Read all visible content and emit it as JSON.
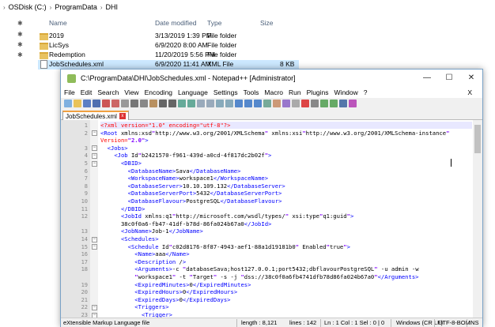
{
  "explorer": {
    "breadcrumb": [
      "OSDisk (C:)",
      "ProgramData",
      "DHI"
    ],
    "columns": {
      "name": "Name",
      "date": "Date modified",
      "type": "Type",
      "size": "Size"
    },
    "files": [
      {
        "name": "2019",
        "date": "3/13/2019 1:39 PM",
        "type": "File folder",
        "size": "",
        "icon": "folder-icon"
      },
      {
        "name": "LicSys",
        "date": "6/9/2020 8:00 AM",
        "type": "File folder",
        "size": "",
        "icon": "folder-icon"
      },
      {
        "name": "Redemption",
        "date": "11/20/2019 5:56 PM",
        "type": "File folder",
        "size": "",
        "icon": "folder-icon"
      },
      {
        "name": "JobSchedules.xml",
        "date": "6/9/2020 11:41 AM",
        "type": "XML File",
        "size": "8 KB",
        "icon": "xml-file-icon"
      }
    ]
  },
  "npp": {
    "title": "C:\\ProgramData\\DHI\\JobSchedules.xml - Notepad++ [Administrator]",
    "menu": [
      "File",
      "Edit",
      "Search",
      "View",
      "Encoding",
      "Language",
      "Settings",
      "Tools",
      "Macro",
      "Run",
      "Plugins",
      "Window",
      "?"
    ],
    "menu_close": "X",
    "tab_label": "JobSchedules.xml",
    "tab_close": "x",
    "minimize": "—",
    "maximize": "☐",
    "close": "✕",
    "lines": [
      {
        "n": "1",
        "fold": "",
        "text": "<?xml version=\"1.0\" encoding=\"utf-8\"?>"
      },
      {
        "n": "2",
        "fold": "−",
        "text": "<Root xmlns:xsd=\"http://www.w3.org/2001/XMLSchema\" xmlns:xsi=\"http://www.w3.org/2001/XMLSchema-instance\""
      },
      {
        "n": "",
        "fold": "",
        "text": "Version=\"2.0\">"
      },
      {
        "n": "3",
        "fold": "−",
        "text": "<Jobs>"
      },
      {
        "n": "4",
        "fold": "−",
        "text": "<Job Id=\"b2421570-f961-439d-a0cd-4f817dc2b02f\">"
      },
      {
        "n": "5",
        "fold": "−",
        "text": "<DBID>"
      },
      {
        "n": "6",
        "fold": "",
        "text": "<DatabaseName>Sava</DatabaseName>"
      },
      {
        "n": "7",
        "fold": "",
        "text": "<WorkspaceName>workspace1</WorkspaceName>"
      },
      {
        "n": "8",
        "fold": "",
        "text": "<DatabaseServer>10.10.109.132</DatabaseServer>"
      },
      {
        "n": "9",
        "fold": "",
        "text": "<DatabaseServerPort>5432</DatabaseServerPort>"
      },
      {
        "n": "10",
        "fold": "",
        "text": "<DatabaseFlavour>PostgreSQL</DatabaseFlavour>"
      },
      {
        "n": "11",
        "fold": "",
        "text": "</DBID>"
      },
      {
        "n": "12",
        "fold": "",
        "text": "<JobId xmlns:q1=\"http://microsoft.com/wsdl/types/\" xsi:type=\"q1:guid\">"
      },
      {
        "n": "",
        "fold": "",
        "text": "38c0f0a6-fb47-41df-b78d-86fa024b67a0</JobId>"
      },
      {
        "n": "13",
        "fold": "",
        "text": "<JobName>Job-1</JobName>"
      },
      {
        "n": "14",
        "fold": "−",
        "text": "<Schedules>"
      },
      {
        "n": "15",
        "fold": "−",
        "text": "<Schedule Id=\"c02d8176-8f87-4943-aef1-88a1d19181b0\" Enabled=\"true\">"
      },
      {
        "n": "16",
        "fold": "",
        "text": "<Name>aaa</Name>"
      },
      {
        "n": "17",
        "fold": "",
        "text": "<Description />"
      },
      {
        "n": "18",
        "fold": "",
        "text": "<Arguments>-c \"database=Sava;host=127.0.0.1;port=5432;dbflavour=PostgreSQL\" -u admin -w"
      },
      {
        "n": "",
        "fold": "",
        "text": "\"workspace1\" -t \"Target\" -s -j \"dss://38c0f0a6fb4741dfb78d86fa024b67a0\"</Arguments>"
      },
      {
        "n": "19",
        "fold": "",
        "text": "<ExpiredMinutes>0</ExpiredMinutes>"
      },
      {
        "n": "20",
        "fold": "",
        "text": "<ExpiredHours>0</ExpiredHours>"
      },
      {
        "n": "21",
        "fold": "",
        "text": "<ExpiredDays>0</ExpiredDays>"
      },
      {
        "n": "22",
        "fold": "−",
        "text": "<Triggers>"
      },
      {
        "n": "23",
        "fold": "−",
        "text": "<Trigger>"
      }
    ],
    "status": {
      "filetype": "eXtensible Markup Language file",
      "length": "length : 8,121",
      "lines": "lines : 142",
      "pos": "Ln : 1   Col : 1   Sel : 0 | 0",
      "eol": "Windows (CR LF)",
      "encoding": "UTF-8-BOM",
      "mode": "INS"
    }
  }
}
